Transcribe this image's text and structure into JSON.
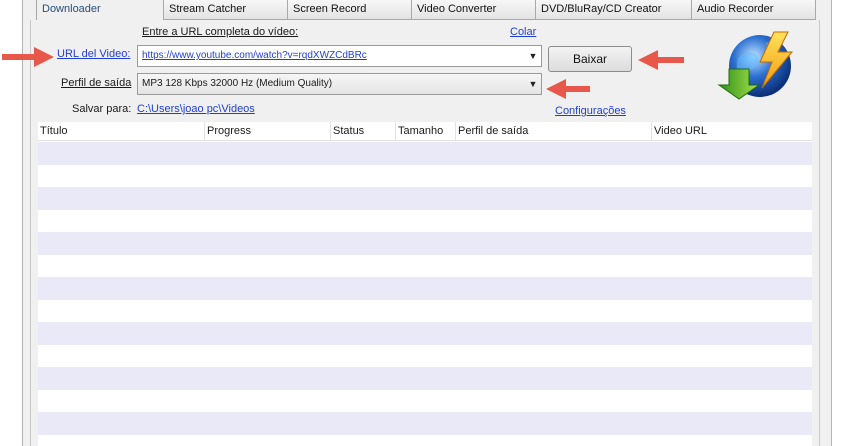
{
  "tabs": [
    {
      "label": "Downloader",
      "active": true
    },
    {
      "label": "Stream Catcher",
      "active": false
    },
    {
      "label": "Screen Record",
      "active": false
    },
    {
      "label": "Video Converter",
      "active": false
    },
    {
      "label": "DVD/BluRay/CD Creator",
      "active": false
    },
    {
      "label": "Audio Recorder",
      "active": false
    }
  ],
  "form": {
    "url_prompt": "Entre a URL completa do vídeo:",
    "paste_link": "Colar",
    "url_label": "URL del Video:",
    "url_value": "https://www.youtube.com/watch?v=rqdXWZCdBRc",
    "download_button": "Baixar",
    "profile_label": "Perfil de saída",
    "profile_value": "MP3 128 Kbps 32000 Hz (Medium Quality)",
    "save_label": "Salvar para:",
    "save_path": "C:\\Users\\joao pc\\Videos",
    "settings_link": "Configurações"
  },
  "table": {
    "columns": [
      "Título",
      "Progress",
      "Status",
      "Tamanho",
      "Perfil de saída",
      "Video URL"
    ],
    "rows": []
  },
  "colors": {
    "annotation_arrow": "#e8584a",
    "link": "#1f3fd0",
    "row_alt": "#e9e9f8",
    "active_tab_text": "#2a4e7a"
  },
  "icons": {
    "logo": "globe-download-lightning-icon",
    "dropdown": "chevron-down-icon",
    "annotation": "arrow-annotation-icon"
  }
}
